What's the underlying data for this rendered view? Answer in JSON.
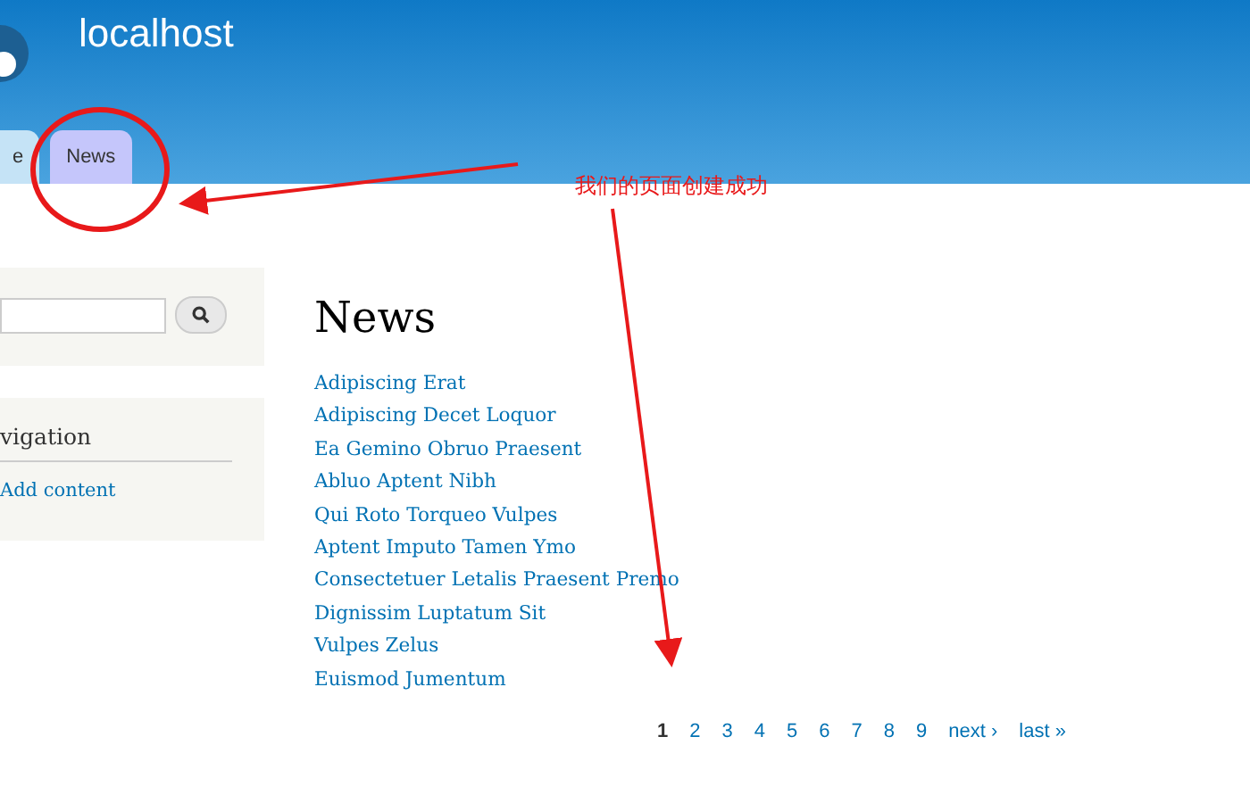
{
  "site": {
    "title": "localhost"
  },
  "tabs": [
    {
      "label": "e",
      "selected": false
    },
    {
      "label": "News",
      "selected": true
    }
  ],
  "sidebar": {
    "navigation": {
      "title": "vigation",
      "links": [
        "Add content"
      ]
    }
  },
  "content": {
    "title": "News",
    "links": [
      "Adipiscing Erat",
      "Adipiscing Decet Loquor",
      "Ea Gemino Obruo Praesent",
      "Abluo Aptent Nibh",
      "Qui Roto Torqueo Vulpes",
      "Aptent Imputo Tamen Ymo",
      "Consectetuer Letalis Praesent Premo",
      "Dignissim Luptatum Sit",
      "Vulpes Zelus",
      "Euismod Jumentum"
    ]
  },
  "pager": [
    {
      "label": "1",
      "selected": true
    },
    {
      "label": "2",
      "selected": false
    },
    {
      "label": "3",
      "selected": false
    },
    {
      "label": "4",
      "selected": false
    },
    {
      "label": "5",
      "selected": false
    },
    {
      "label": "6",
      "selected": false
    },
    {
      "label": "7",
      "selected": false
    },
    {
      "label": "8",
      "selected": false
    },
    {
      "label": "9",
      "selected": false
    },
    {
      "label": "next ›",
      "selected": false
    },
    {
      "label": "last »",
      "selected": false
    }
  ],
  "annotation": {
    "text": "我们的页面创建成功"
  }
}
